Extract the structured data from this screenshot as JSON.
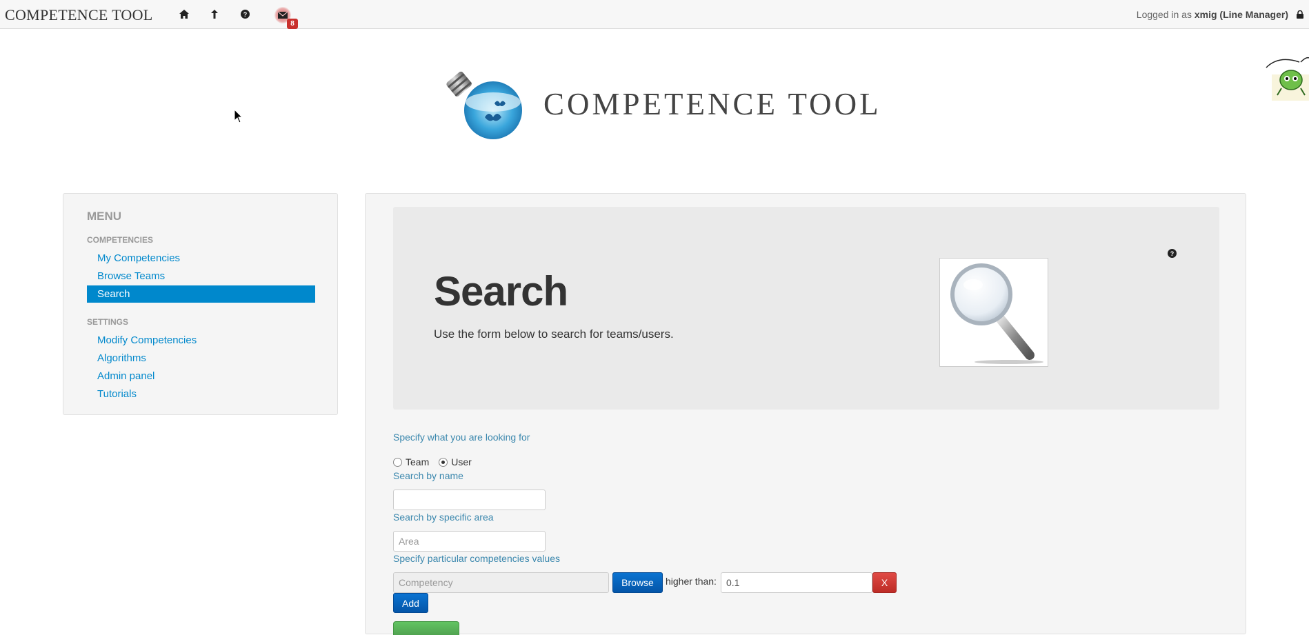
{
  "topbar": {
    "brand": "COMPETENCE TOOL",
    "icons": [
      "home-icon",
      "arrow-up-icon",
      "help-icon",
      "mail-icon"
    ],
    "mail_badge": "8",
    "login_prefix": "Logged in as",
    "login_user": "xmig (Line Manager)"
  },
  "header": {
    "title": "COMPETENCE TOOL"
  },
  "sidebar": {
    "menu_title": "MENU",
    "sections": [
      {
        "title": "COMPETENCIES",
        "items": [
          "My Competencies",
          "Browse Teams",
          "Search"
        ]
      },
      {
        "title": "SETTINGS",
        "items": [
          "Modify Competencies",
          "Algorithms",
          "Admin panel",
          "Tutorials"
        ]
      }
    ],
    "active_item": "Search"
  },
  "hero": {
    "title": "Search",
    "subtitle": "Use the form below to search for teams/users."
  },
  "form": {
    "specify_label": "Specify what you are looking for",
    "radio_team": "Team",
    "radio_user": "User",
    "selected": "User",
    "name_label": "Search by name",
    "name_value": "",
    "area_label": "Search by specific area",
    "area_placeholder": "Area",
    "values_label": "Specify particular competencies values",
    "competency_placeholder": "Competency",
    "browse_label": "Browse",
    "higher_than_label": "higher than:",
    "threshold_value": "0.1",
    "remove_label": "X",
    "add_label": "Add"
  },
  "colors": {
    "accent": "#0088cc",
    "label": "#3a87ad",
    "danger": "#bd2c26",
    "success": "#51a351"
  }
}
